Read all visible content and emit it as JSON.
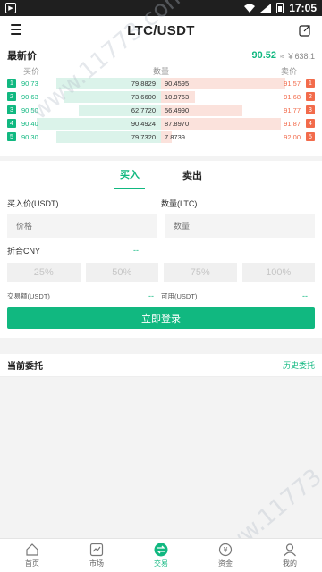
{
  "status": {
    "time": "17:05"
  },
  "header": {
    "title": "LTC/USDT"
  },
  "latest": {
    "label": "最新价",
    "price": "90.52",
    "cny": "≈ ￥638.1"
  },
  "book_headers": {
    "bid": "买价",
    "qty": "数量",
    "ask": "卖价"
  },
  "book": [
    {
      "idx": "1",
      "bid": "90.73",
      "bid_qty": "79.8829",
      "ask_qty": "90.4595",
      "ask": "91.57",
      "bid_fill": 0.8,
      "ask_fill": 0.95
    },
    {
      "idx": "2",
      "bid": "90.63",
      "bid_qty": "73.6600",
      "ask_qty": "10.9763",
      "ask": "91.68",
      "bid_fill": 0.74,
      "ask_fill": 0.26
    },
    {
      "idx": "3",
      "bid": "90.50",
      "bid_qty": "62.7720",
      "ask_qty": "56.4990",
      "ask": "91.77",
      "bid_fill": 0.63,
      "ask_fill": 0.62
    },
    {
      "idx": "4",
      "bid": "90.40",
      "bid_qty": "90.4924",
      "ask_qty": "87.8970",
      "ask": "91.87",
      "bid_fill": 0.95,
      "ask_fill": 0.92
    },
    {
      "idx": "5",
      "bid": "90.30",
      "bid_qty": "79.7320",
      "ask_qty": "7.8739",
      "ask": "92.00",
      "bid_fill": 0.8,
      "ask_fill": 0.08
    }
  ],
  "trade": {
    "tab_buy": "买入",
    "tab_sell": "卖出",
    "price_label": "买入价(USDT)",
    "qty_label": "数量(LTC)",
    "price_placeholder": "价格",
    "qty_placeholder": "数量",
    "cny_label": "折合CNY",
    "cny_value": "--",
    "percents": [
      "25%",
      "50%",
      "75%",
      "100%"
    ],
    "amount_label": "交易额(USDT)",
    "amount_value": "--",
    "available_label": "可用(USDT)",
    "available_value": "--",
    "login_button": "立即登录"
  },
  "orders": {
    "title": "当前委托",
    "history_link": "历史委托"
  },
  "watermark": "www.11773.com",
  "nav": [
    {
      "label": "首页",
      "icon": "home-icon"
    },
    {
      "label": "市场",
      "icon": "market-icon"
    },
    {
      "label": "交易",
      "icon": "exchange-icon"
    },
    {
      "label": "资金",
      "icon": "wallet-icon"
    },
    {
      "label": "我的",
      "icon": "user-icon"
    }
  ]
}
